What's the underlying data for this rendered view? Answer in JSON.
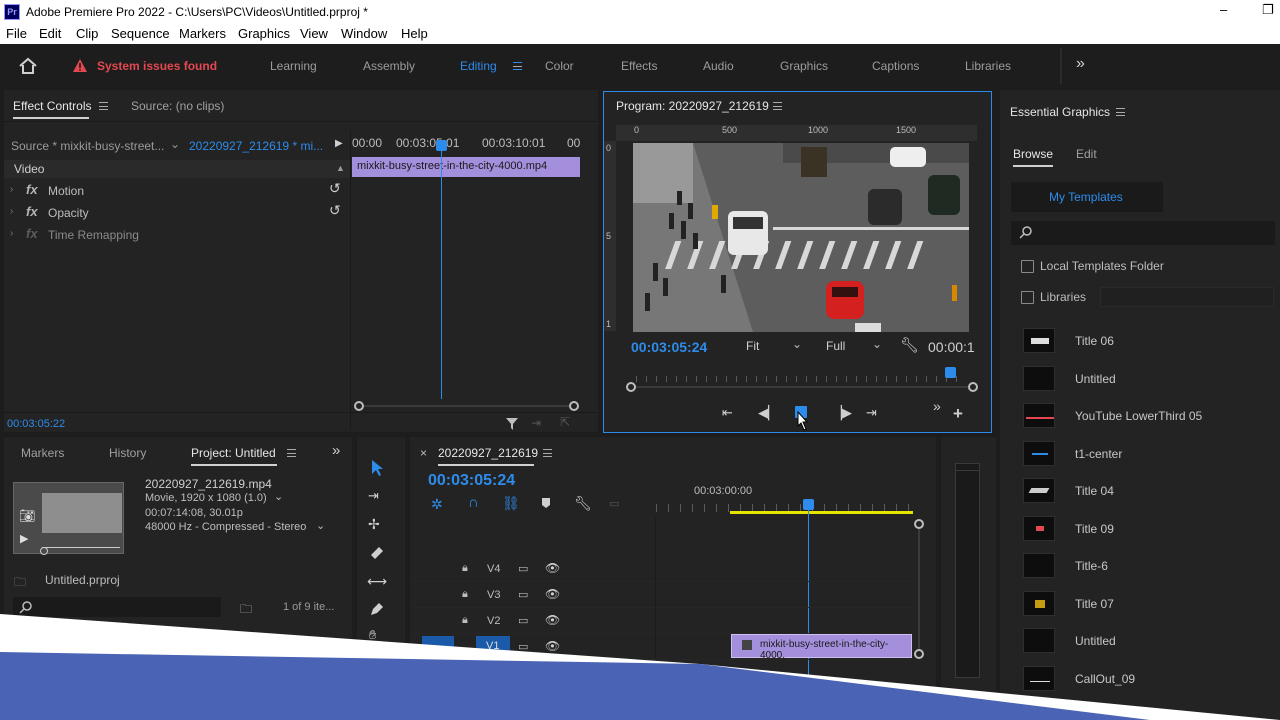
{
  "window": {
    "app_badge": "Pr",
    "title": "Adobe Premiere Pro 2022 - C:\\Users\\PC\\Videos\\Untitled.prproj *",
    "minimize": "–",
    "maximize": "❐"
  },
  "menu": [
    "File",
    "Edit",
    "Clip",
    "Sequence",
    "Markers",
    "Graphics",
    "View",
    "Window",
    "Help"
  ],
  "workspace": {
    "warning": "System issues found",
    "tabs": [
      "Learning",
      "Assembly",
      "Editing",
      "Color",
      "Effects",
      "Audio",
      "Graphics",
      "Captions",
      "Libraries"
    ],
    "active": "Editing"
  },
  "effect_controls": {
    "tab_active": "Effect Controls",
    "tab_source": "Source: (no clips)",
    "source_label": "Source * mixkit-busy-street...",
    "sequence_label": "20220927_212619 * mi...",
    "ruler": [
      "00:00",
      "00:03:05:01",
      "00:03:10:01",
      "00"
    ],
    "clip_label": "mixkit-busy-street-in-the-city-4000.mp4",
    "section": "Video",
    "effects": [
      "Motion",
      "Opacity",
      "Time Remapping"
    ],
    "fx": "fx",
    "timecode": "00:03:05:22"
  },
  "program": {
    "title": "Program: 20220927_212619",
    "ruler_h": [
      "0",
      "500",
      "1000",
      "1500"
    ],
    "ruler_v": [
      "0",
      "5",
      "1"
    ],
    "timecode": "00:03:05:24",
    "fit": "Fit",
    "quality": "Full",
    "duration": "00:00:1",
    "playhead_fraction": 0.95
  },
  "essential_graphics": {
    "title": "Essential Graphics",
    "tabs": [
      "Browse",
      "Edit"
    ],
    "dropdown": "My Templates",
    "search_placeholder": "",
    "checkboxes": [
      "Local Templates Folder",
      "Libraries"
    ],
    "templates": [
      "Title 06",
      "Untitled",
      "YouTube LowerThird 05",
      "t1-center",
      "Title 04",
      "Title 09",
      "Title-6",
      "Title 07",
      "Untitled",
      "CallOut_09"
    ]
  },
  "project": {
    "tabs": [
      "Markers",
      "History",
      "Project: Untitled"
    ],
    "clip_name": "20220927_212619.mp4",
    "clip_info": [
      "Movie, 1920 x 1080 (1.0)",
      "00:07:14:08, 30.01p",
      "48000 Hz - Compressed - Stereo"
    ],
    "file": "Untitled.prproj",
    "count": "1 of 9 ite..."
  },
  "timeline": {
    "sequence": "20220927_212619",
    "timecode": "00:03:05:24",
    "ruler": "00:03:00:00",
    "tracks": [
      "V4",
      "V3",
      "V2",
      "V1"
    ],
    "clip_label": "mixkit-busy-street-in-the-city-4000."
  },
  "colors": {
    "accent": "#2d8ceb",
    "clip": "#a38fdb",
    "warning": "#e34850",
    "overlay_blue": "#4a63b4"
  }
}
